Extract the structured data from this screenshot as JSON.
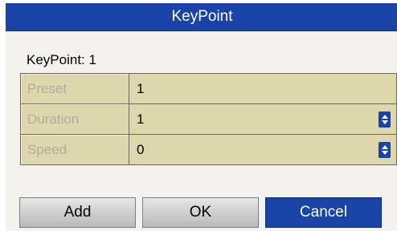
{
  "dialog": {
    "title": "KeyPoint",
    "heading": "KeyPoint: 1"
  },
  "fields": [
    {
      "label": "Preset",
      "value": "1",
      "has_spinner": false
    },
    {
      "label": "Duration",
      "value": "1",
      "has_spinner": true
    },
    {
      "label": "Speed",
      "value": "0",
      "has_spinner": true
    }
  ],
  "buttons": {
    "add": "Add",
    "ok": "OK",
    "cancel": "Cancel"
  },
  "colors": {
    "titlebar": "#1a43a8",
    "field_background": "#ddd7ad",
    "label_text_disabled": "#b2ad98"
  }
}
